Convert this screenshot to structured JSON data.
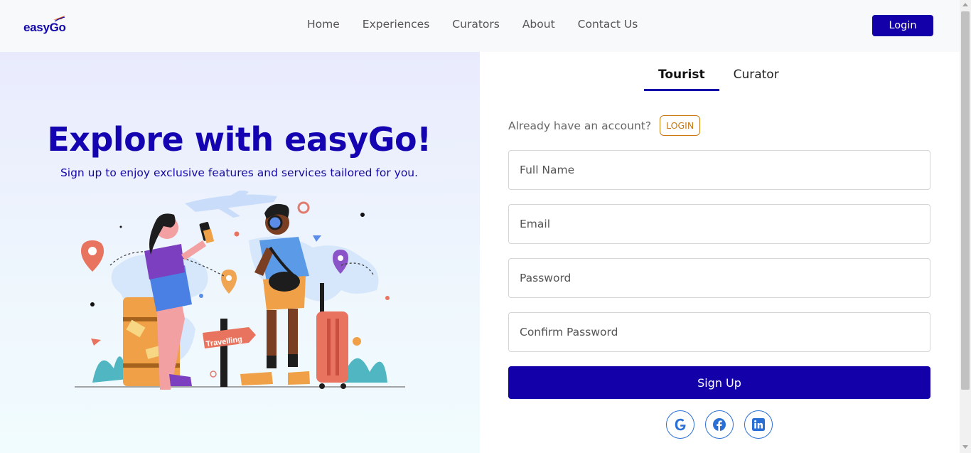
{
  "header": {
    "logo_text": "easyGo",
    "nav": [
      "Home",
      "Experiences",
      "Curators",
      "About",
      "Contact Us"
    ],
    "login_label": "Login"
  },
  "hero": {
    "title": "Explore with easyGo!",
    "subtitle": "Sign up to enjoy exclusive features and services tailored for you.",
    "illustration_sign": "Travelling"
  },
  "form": {
    "tabs": [
      {
        "label": "Tourist",
        "active": true
      },
      {
        "label": "Curator",
        "active": false
      }
    ],
    "account_prompt": "Already have an account?",
    "account_login": "LOGIN",
    "fields": {
      "full_name": "Full Name",
      "email": "Email",
      "password": "Password",
      "confirm_password": "Confirm Password"
    },
    "submit_label": "Sign Up",
    "socials": [
      "google-icon",
      "facebook-icon",
      "linkedin-icon"
    ]
  },
  "colors": {
    "brand": "#1300a8",
    "accent_orange": "#c67a12",
    "social_blue": "#2a6fd6"
  }
}
